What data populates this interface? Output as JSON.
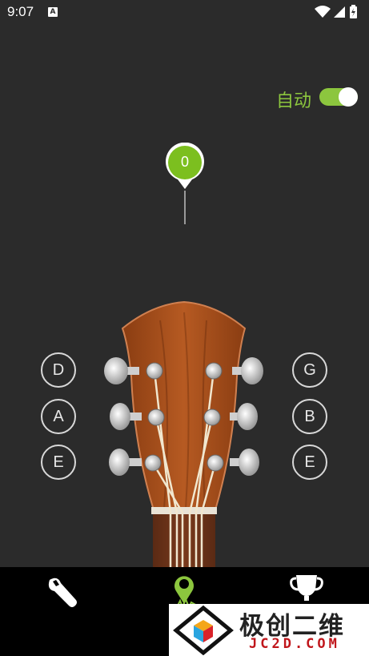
{
  "status_bar": {
    "time": "9:07",
    "notification_icon": "A",
    "icons": [
      "wifi-icon",
      "signal-icon",
      "battery-charging-icon"
    ]
  },
  "tuner": {
    "auto_label": "自动",
    "auto_mode_on": true,
    "needle_value": "0",
    "accent_color": "#8cc63e"
  },
  "strings": {
    "left": [
      "D",
      "A",
      "E"
    ],
    "right": [
      "G",
      "B",
      "E"
    ]
  },
  "bottom_nav": {
    "items": [
      "wrench-icon",
      "tuner-pin-icon",
      "trophy-icon"
    ],
    "active_index": 1
  },
  "watermark": {
    "title": "极创二维",
    "subtitle": "JC2D.COM"
  }
}
